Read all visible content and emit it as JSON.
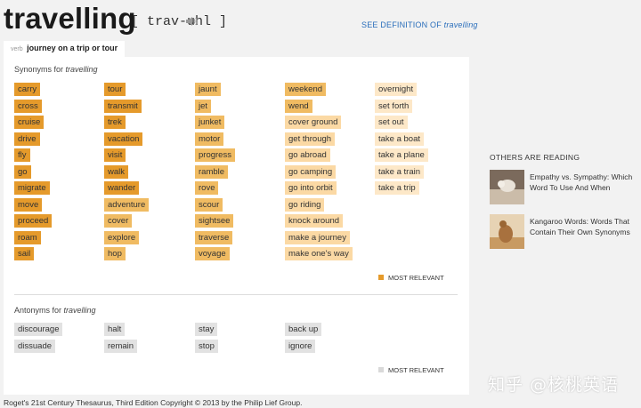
{
  "header": {
    "word": "travelling",
    "pronunciation": "[ trav-uhl ]",
    "speaker_icon": "speaker-icon",
    "see_definition_prefix": "SEE DEFINITION OF",
    "see_definition_word": "travelling"
  },
  "tab": {
    "pos": "verb",
    "sense": "journey on a trip or tour"
  },
  "synonyms": {
    "label_prefix": "Synonyms for",
    "label_word": "travelling",
    "columns": [
      [
        "carry",
        "cross",
        "cruise",
        "drive",
        "fly",
        "go",
        "migrate",
        "move",
        "proceed",
        "roam",
        "sail"
      ],
      [
        "tour",
        "transmit",
        "trek",
        "vacation",
        "visit",
        "walk",
        "wander",
        "adventure",
        "cover",
        "explore",
        "hop"
      ],
      [
        "jaunt",
        "jet",
        "junket",
        "motor",
        "progress",
        "ramble",
        "rove",
        "scour",
        "sightsee",
        "traverse",
        "voyage"
      ],
      [
        "weekend",
        "wend",
        "cover ground",
        "get through",
        "go abroad",
        "go camping",
        "go into orbit",
        "go riding",
        "knock around",
        "make a journey",
        "make one's way"
      ],
      [
        "overnight",
        "set forth",
        "set out",
        "take a boat",
        "take a plane",
        "take a train",
        "take a trip"
      ]
    ],
    "relevance": [
      [
        1,
        1,
        1,
        1,
        1,
        1,
        1,
        1,
        1,
        1,
        1
      ],
      [
        1,
        1,
        1,
        1,
        1,
        1,
        1,
        2,
        2,
        2,
        2
      ],
      [
        2,
        2,
        2,
        2,
        2,
        2,
        2,
        2,
        2,
        2,
        2
      ],
      [
        2,
        2,
        3,
        3,
        3,
        3,
        3,
        3,
        3,
        3,
        3
      ],
      [
        4,
        4,
        4,
        4,
        4,
        4,
        4
      ]
    ],
    "legend": "MOST RELEVANT",
    "legend_color": "#e59a2b"
  },
  "antonyms": {
    "label_prefix": "Antonyms for",
    "label_word": "travelling",
    "columns": [
      [
        "discourage",
        "dissuade"
      ],
      [
        "halt",
        "remain"
      ],
      [
        "stay",
        "stop"
      ],
      [
        "back up",
        "ignore"
      ]
    ],
    "legend": "MOST RELEVANT",
    "legend_color": "#d9d9d9"
  },
  "copyright": "Roget's 21st Century Thesaurus, Third Edition Copyright © 2013 by the Philip Lief Group.",
  "sidebar": {
    "title": "OTHERS ARE READING",
    "articles": [
      {
        "title": "Empathy vs. Sympathy: Which Word To Use And When"
      },
      {
        "title": "Kangaroo Words: Words That Contain Their Own Synonyms"
      }
    ]
  },
  "watermark": "知乎 @核桃英语",
  "colors": {
    "link": "#2a6ebb",
    "r1": "#e59a2b",
    "r2": "#f0bb62",
    "r3": "#fbd9a4",
    "r4": "#fde8c8",
    "antonym": "#e2e2e2"
  }
}
